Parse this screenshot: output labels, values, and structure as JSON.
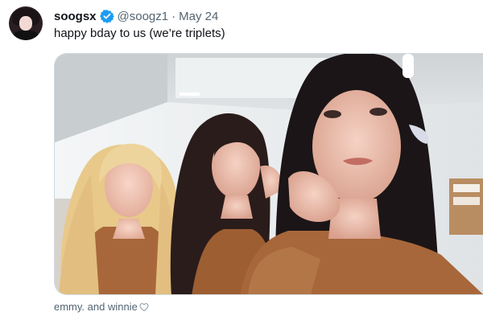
{
  "tweet": {
    "display_name": "soogsx",
    "handle": "@soogz1",
    "separator": "·",
    "date": "May 24",
    "text": "happy bday to us (we’re triplets)",
    "verified_color": "#1d9bf0"
  },
  "media": {
    "caption": "emmy. and winnie",
    "caption_icon": "heart-icon"
  }
}
